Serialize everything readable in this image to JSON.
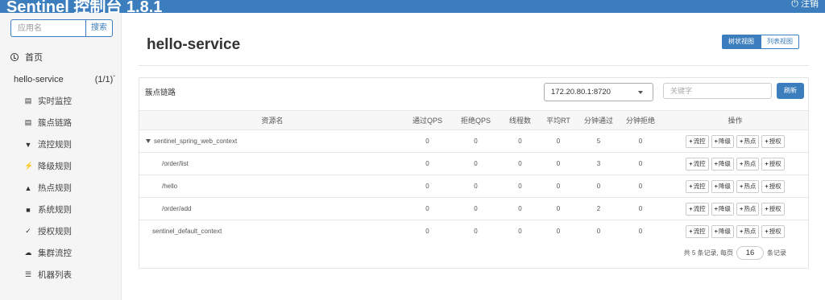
{
  "topbar": {
    "brand": "Sentinel 控制台 1.8.1",
    "logout": "注销"
  },
  "sidebar": {
    "search_placeholder": "应用名",
    "search_button": "搜索",
    "home_label": "首页",
    "app": {
      "name": "hello-service",
      "count": "(1/1)"
    },
    "items": [
      {
        "label": "实时监控",
        "icon": "chart-icon"
      },
      {
        "label": "簇点链路",
        "icon": "list-icon"
      },
      {
        "label": "流控规则",
        "icon": "filter-icon"
      },
      {
        "label": "降级规则",
        "icon": "flash-icon"
      },
      {
        "label": "热点规则",
        "icon": "fire-icon"
      },
      {
        "label": "系统规则",
        "icon": "lock-icon"
      },
      {
        "label": "授权规则",
        "icon": "check-icon"
      },
      {
        "label": "集群流控",
        "icon": "cloud-icon"
      },
      {
        "label": "机器列表",
        "icon": "th-list-icon"
      }
    ]
  },
  "main": {
    "title": "hello-service",
    "view_toggle": {
      "tree": "树状视图",
      "list": "列表视图"
    },
    "panel": {
      "title": "簇点链路",
      "ip_selected": "172.20.80.1:8720",
      "keyword_placeholder": "关键字",
      "refresh": "刷新"
    },
    "table": {
      "headers": [
        "资源名",
        "通过QPS",
        "拒绝QPS",
        "线程数",
        "平均RT",
        "分钟通过",
        "分钟拒绝",
        "操作"
      ],
      "rows": [
        {
          "name": "sentinel_spring_web_context",
          "values": [
            "0",
            "0",
            "0",
            "0",
            "5",
            "0"
          ]
        },
        {
          "name": "/order/list",
          "values": [
            "0",
            "0",
            "0",
            "0",
            "3",
            "0"
          ]
        },
        {
          "name": "/hello",
          "values": [
            "0",
            "0",
            "0",
            "0",
            "0",
            "0"
          ]
        },
        {
          "name": "/order/add",
          "values": [
            "0",
            "0",
            "0",
            "0",
            "2",
            "0"
          ]
        },
        {
          "name": "sentinel_default_context",
          "values": [
            "0",
            "0",
            "0",
            "0",
            "0",
            "0"
          ]
        }
      ],
      "ops": [
        "流控",
        "降级",
        "热点",
        "授权"
      ]
    },
    "pager": {
      "prefix": "共 5 条记录, 每页",
      "page_size": "16",
      "suffix": "条记录"
    }
  }
}
